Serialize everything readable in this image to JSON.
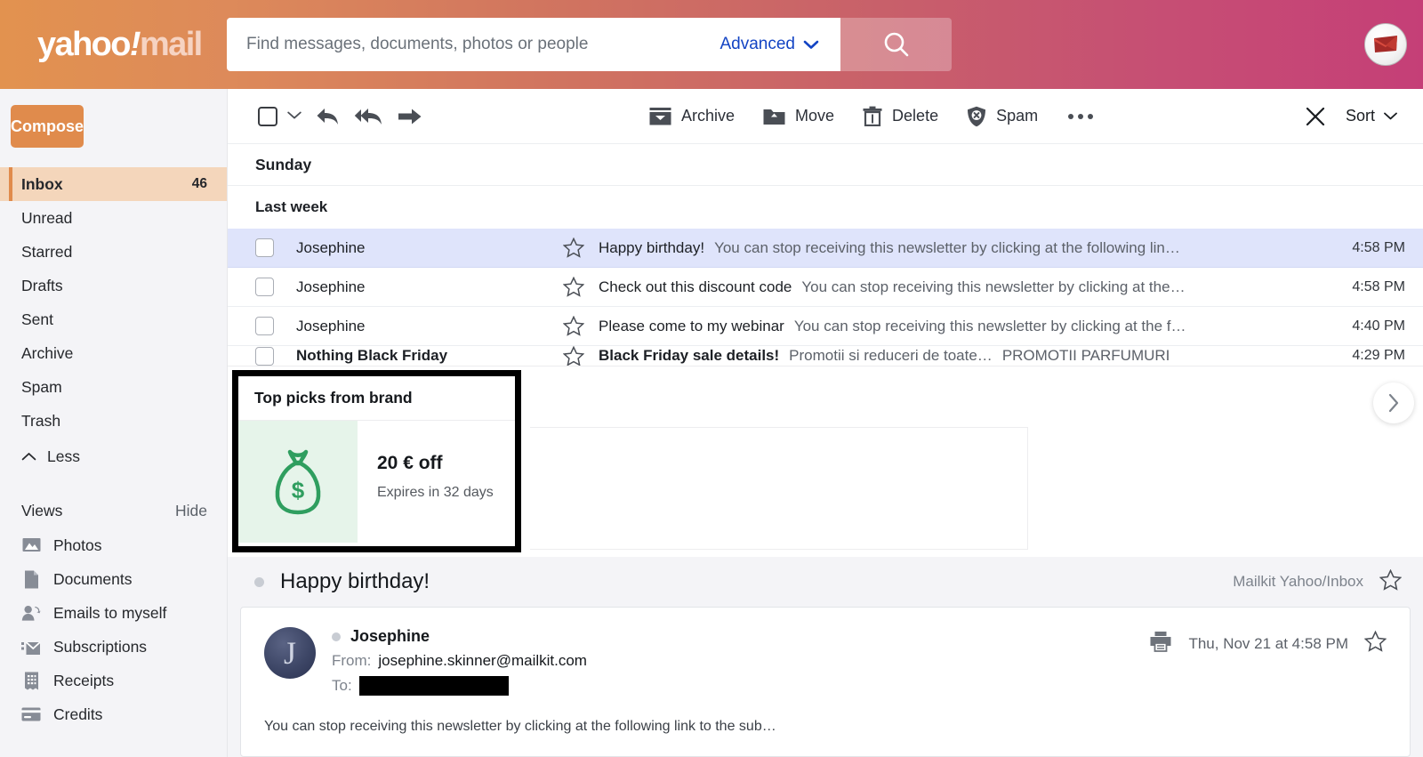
{
  "header": {
    "logo_yahoo": "yahoo",
    "logo_bang": "!",
    "logo_mail": "mail",
    "search_placeholder": "Find messages, documents, photos or people",
    "search_value": "",
    "advanced_label": "Advanced",
    "search_icon": "search-icon",
    "avatar_icon": "envelope-avatar-icon",
    "gradient_start": "#e2924f",
    "gradient_end": "#c53f77"
  },
  "sidebar": {
    "compose_label": "Compose",
    "folders": [
      {
        "label": "Inbox",
        "count": "46",
        "active": true
      },
      {
        "label": "Unread",
        "count": "",
        "active": false
      },
      {
        "label": "Starred",
        "count": "",
        "active": false
      },
      {
        "label": "Drafts",
        "count": "",
        "active": false
      },
      {
        "label": "Sent",
        "count": "",
        "active": false
      },
      {
        "label": "Archive",
        "count": "",
        "active": false
      },
      {
        "label": "Spam",
        "count": "",
        "active": false
      },
      {
        "label": "Trash",
        "count": "",
        "active": false
      }
    ],
    "less_label": "Less",
    "views_label": "Views",
    "views_hide_label": "Hide",
    "views": [
      {
        "label": "Photos",
        "icon": "photos-icon"
      },
      {
        "label": "Documents",
        "icon": "document-icon"
      },
      {
        "label": "Emails to myself",
        "icon": "person-reply-icon"
      },
      {
        "label": "Subscriptions",
        "icon": "subscriptions-icon"
      },
      {
        "label": "Receipts",
        "icon": "receipt-icon"
      },
      {
        "label": "Credits",
        "icon": "credit-card-icon"
      }
    ],
    "accent": "#e08b4c",
    "active_bg": "#f4d6bb"
  },
  "toolbar": {
    "select_all_icon": "checkbox-icon",
    "select_caret_icon": "chevron-down-icon",
    "reply_icon": "reply-icon",
    "reply_all_icon": "reply-all-icon",
    "forward_icon": "forward-icon",
    "archive_label": "Archive",
    "move_label": "Move",
    "delete_label": "Delete",
    "spam_label": "Spam",
    "more_icon": "more-horizontal-icon",
    "close_icon": "close-icon",
    "sort_label": "Sort",
    "sort_caret_icon": "chevron-down-icon"
  },
  "list": {
    "day_header": "Sunday",
    "section_header": "Last week",
    "rows": [
      {
        "sender": "Josephine",
        "subject": "Happy birthday!",
        "snippet": "You can stop receiving this newsletter by clicking at the following lin…",
        "time": "4:58 PM",
        "selected": true
      },
      {
        "sender": "Josephine",
        "subject": "Check out this discount code",
        "snippet": "You can stop receiving this newsletter by clicking at the…",
        "time": "4:58 PM",
        "selected": false
      },
      {
        "sender": "Josephine",
        "subject": "Please come to my webinar",
        "snippet": "You can stop receiving this newsletter by clicking at the f…",
        "time": "4:40 PM",
        "selected": false
      }
    ],
    "clipped_row": {
      "sender": "Nothing Black Friday",
      "subject": "Black Friday sale details!",
      "snippet": "Promotii si reduceri de toate…",
      "tag": "PROMOTII PARFUMURI",
      "time": "4:29 PM"
    }
  },
  "promo": {
    "title": "Top picks from brand",
    "thumb_icon": "money-bag-icon",
    "amount": "20 € off",
    "expiry": "Expires in 32 days",
    "next_icon": "chevron-right-icon",
    "thumb_bg": "#e6f4ea",
    "icon_color": "#2f9e5f"
  },
  "reading": {
    "unread_dot_icon": "unread-dot-icon",
    "title": "Happy birthday!",
    "folder_path": "Mailkit Yahoo/Inbox",
    "star_icon": "star-icon",
    "message": {
      "avatar_initial": "J",
      "avatar_icon": "contact-avatar",
      "sender_name": "Josephine",
      "from_label": "From:",
      "from_value": "josephine.skinner@mailkit.com",
      "to_label": "To:",
      "to_value": "",
      "print_icon": "printer-icon",
      "date": "Thu, Nov 21 at 4:58 PM",
      "star_icon": "star-icon",
      "body_preview": "You can stop receiving this newsletter by clicking at the following link to the sub…"
    }
  }
}
